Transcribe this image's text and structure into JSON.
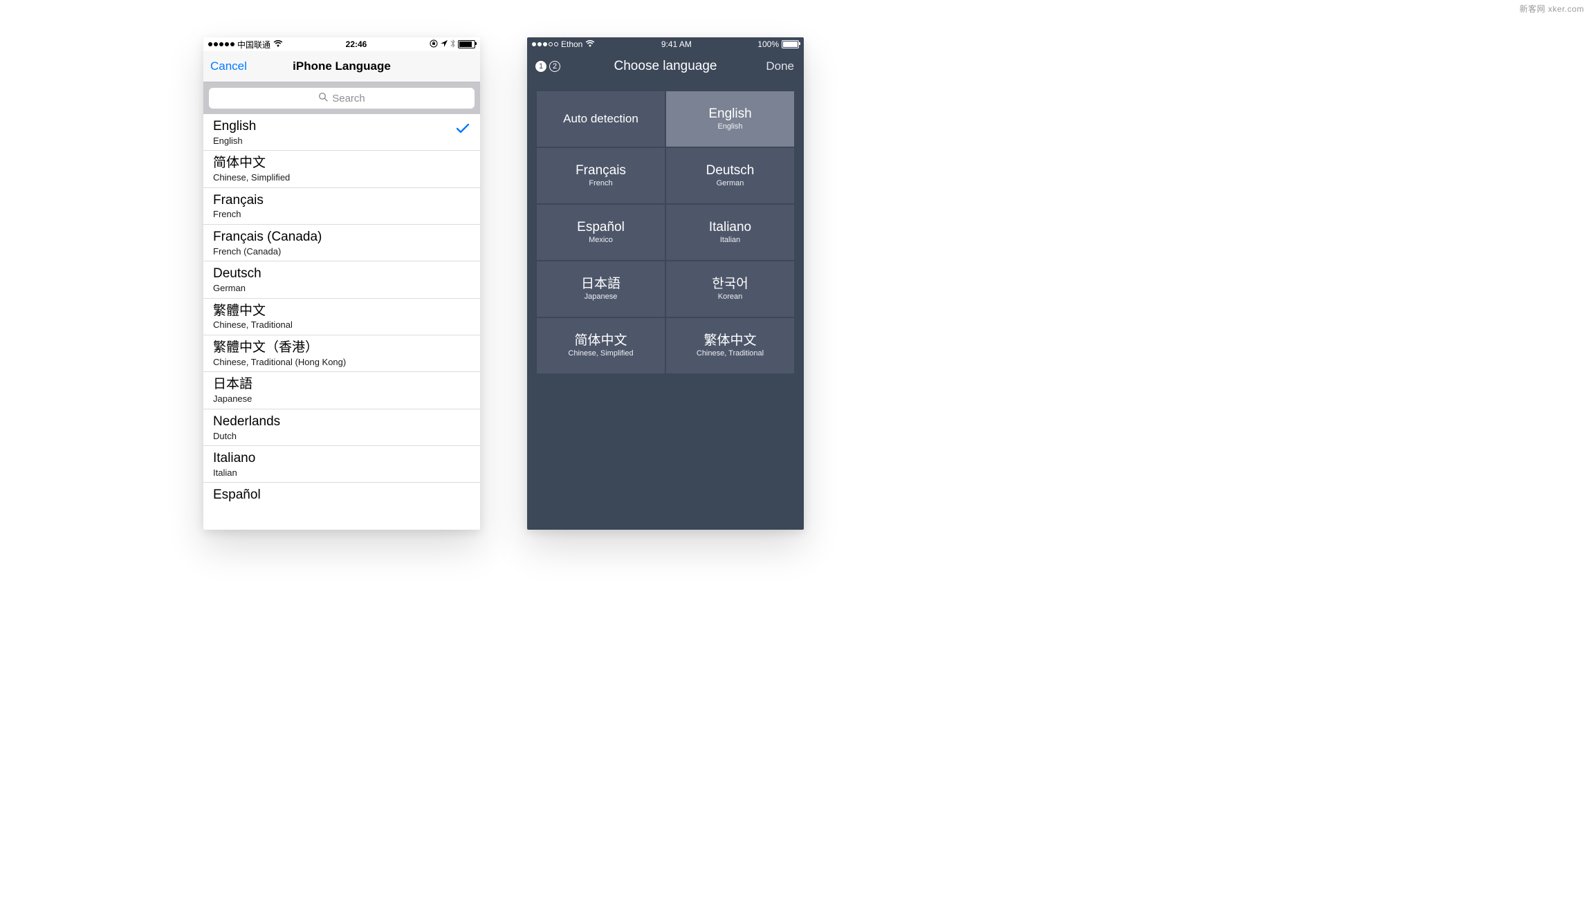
{
  "watermark": "新客网 xker.com",
  "left": {
    "status": {
      "carrier": "中国联通",
      "time": "22:46"
    },
    "nav": {
      "cancel": "Cancel",
      "title": "iPhone Language"
    },
    "search_placeholder": "Search",
    "selected_index": 0,
    "languages": [
      {
        "native": "English",
        "sub": "English"
      },
      {
        "native": "简体中文",
        "sub": "Chinese, Simplified"
      },
      {
        "native": "Français",
        "sub": "French"
      },
      {
        "native": "Français (Canada)",
        "sub": "French (Canada)"
      },
      {
        "native": "Deutsch",
        "sub": "German"
      },
      {
        "native": "繁體中文",
        "sub": "Chinese, Traditional"
      },
      {
        "native": "繁體中文（香港）",
        "sub": "Chinese, Traditional (Hong Kong)"
      },
      {
        "native": "日本語",
        "sub": "Japanese"
      },
      {
        "native": "Nederlands",
        "sub": "Dutch"
      },
      {
        "native": "Italiano",
        "sub": "Italian"
      },
      {
        "native": "Español",
        "sub": ""
      }
    ]
  },
  "right": {
    "status": {
      "carrier": "Ethon",
      "time": "9:41 AM",
      "battery_text": "100%"
    },
    "nav": {
      "title": "Choose language",
      "done": "Done",
      "step1": "1",
      "step2": "2"
    },
    "selected_index": 1,
    "tiles": [
      {
        "native": "Auto detection",
        "sub": "",
        "auto": true
      },
      {
        "native": "English",
        "sub": "English"
      },
      {
        "native": "Français",
        "sub": "French"
      },
      {
        "native": "Deutsch",
        "sub": "German"
      },
      {
        "native": "Español",
        "sub": "Mexico"
      },
      {
        "native": "Italiano",
        "sub": "Italian"
      },
      {
        "native": "日本語",
        "sub": "Japanese"
      },
      {
        "native": "한국어",
        "sub": "Korean"
      },
      {
        "native": "简体中文",
        "sub": "Chinese, Simplified"
      },
      {
        "native": "繁体中文",
        "sub": "Chinese, Traditional"
      }
    ]
  }
}
